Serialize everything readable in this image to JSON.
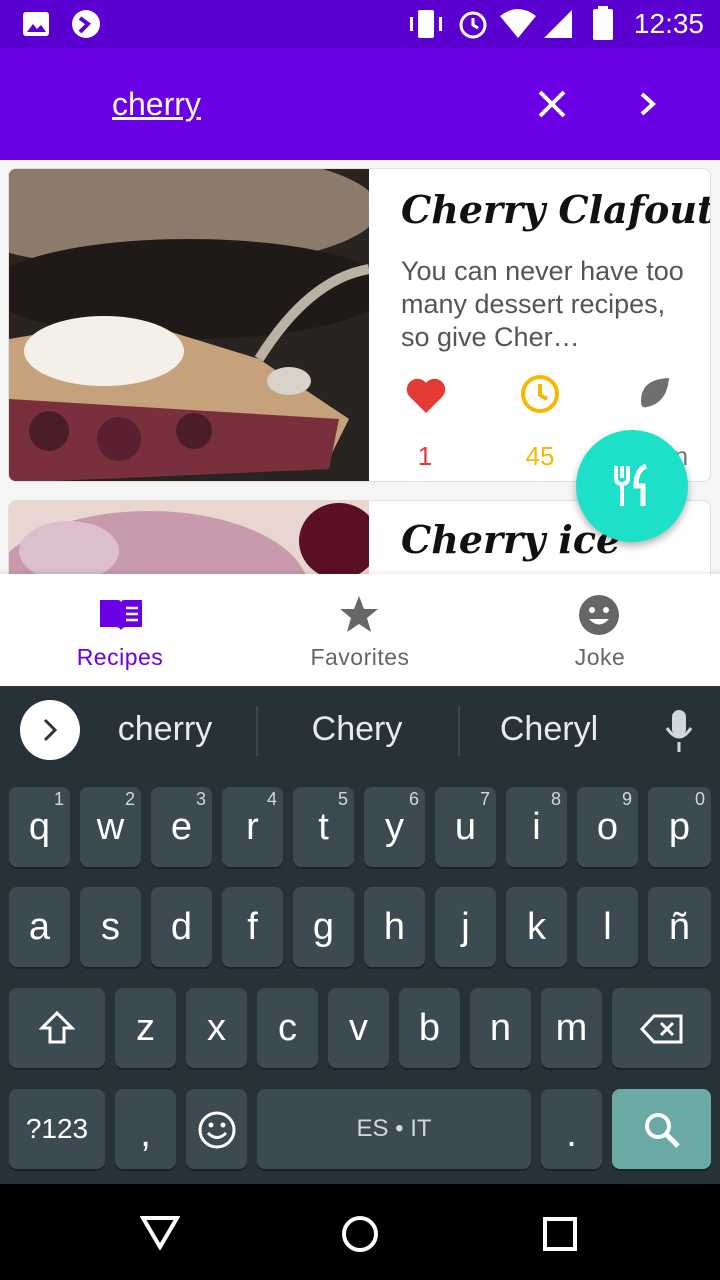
{
  "status_bar": {
    "time": "12:35"
  },
  "search": {
    "query": "cherry"
  },
  "recipes": [
    {
      "title": "Cherry Clafouti",
      "description": "You can never have too many dessert recipes, so give Cher…",
      "likes": "1",
      "minutes": "45",
      "diet_partial": "n"
    },
    {
      "title": "Cherry ice"
    }
  ],
  "bottom_nav": [
    {
      "label": "Recipes",
      "icon": "book-icon",
      "active": true
    },
    {
      "label": "Favorites",
      "icon": "star-icon",
      "active": false
    },
    {
      "label": "Joke",
      "icon": "smiley-icon",
      "active": false
    }
  ],
  "keyboard": {
    "suggestions": [
      "cherry",
      "Chery",
      "Cheryl"
    ],
    "row1": [
      {
        "k": "q",
        "h": "1"
      },
      {
        "k": "w",
        "h": "2"
      },
      {
        "k": "e",
        "h": "3"
      },
      {
        "k": "r",
        "h": "4"
      },
      {
        "k": "t",
        "h": "5"
      },
      {
        "k": "y",
        "h": "6"
      },
      {
        "k": "u",
        "h": "7"
      },
      {
        "k": "i",
        "h": "8"
      },
      {
        "k": "o",
        "h": "9"
      },
      {
        "k": "p",
        "h": "0"
      }
    ],
    "row2": [
      "a",
      "s",
      "d",
      "f",
      "g",
      "h",
      "j",
      "k",
      "l",
      "ñ"
    ],
    "row3": [
      "z",
      "x",
      "c",
      "v",
      "b",
      "n",
      "m"
    ],
    "symbols_label": "?123",
    "comma": ",",
    "space_label": "ES • IT",
    "period": "."
  },
  "colors": {
    "primary": "#6a00e4",
    "accent": "#1de0c8",
    "like": "#e53935",
    "time": "#f9b800"
  }
}
